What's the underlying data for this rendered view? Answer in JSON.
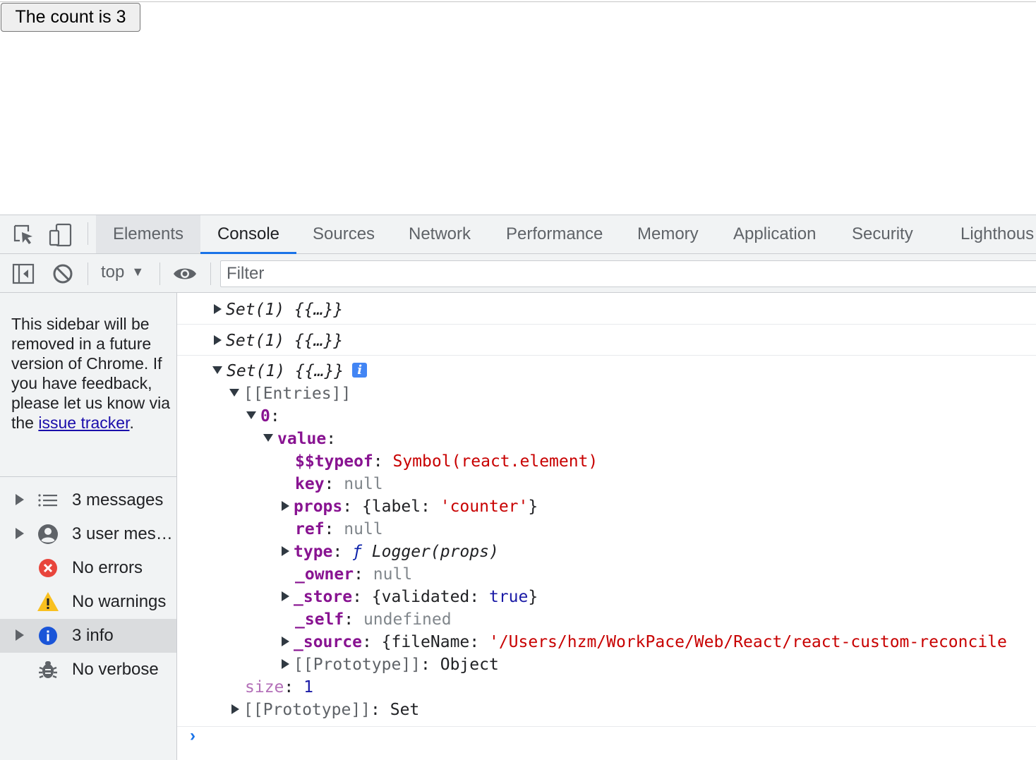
{
  "page": {
    "button_label": "The count is 3"
  },
  "devtools": {
    "tabs": [
      "Elements",
      "Console",
      "Sources",
      "Network",
      "Performance",
      "Memory",
      "Application",
      "Security",
      "Lighthous"
    ],
    "toolbar": {
      "context": "top",
      "filter_placeholder": "Filter"
    },
    "sidebar": {
      "note_text": "This sidebar will be removed in a future version of Chrome. If you have feedback, please let us know via the ",
      "note_link": "issue tracker",
      "note_end": ".",
      "items": [
        {
          "label": "3 messages"
        },
        {
          "label": "3 user mes…"
        },
        {
          "label": "No errors"
        },
        {
          "label": "No warnings"
        },
        {
          "label": "3 info"
        },
        {
          "label": "No verbose"
        }
      ]
    },
    "console": {
      "entry_label": "Set(1) {{…}}",
      "entries_key": "[[Entries]]",
      "index_key": "0",
      "value_key": "value",
      "typeof_key": "$$typeof",
      "typeof_val": "Symbol(react.element)",
      "key_key": "key",
      "null_val": "null",
      "props_key": "props",
      "props_open": "{label: ",
      "props_str": "'counter'",
      "props_close": "}",
      "ref_key": "ref",
      "type_key": "type",
      "type_f": "ƒ",
      "type_val": "Logger(props)",
      "owner_key": "_owner",
      "store_key": "_store",
      "store_open": "{validated: ",
      "store_bool": "true",
      "store_close": "}",
      "self_key": "_self",
      "self_val": "undefined",
      "source_key": "_source",
      "source_open": "{fileName: ",
      "source_str": "'/Users/hzm/WorkPace/Web/React/react-custom-reconcile",
      "proto_key": "[[Prototype]]",
      "proto_obj": "Object",
      "size_key": "size",
      "size_val": "1",
      "proto_set": "Set",
      "prompt": "›"
    }
  },
  "colors": {
    "accent": "#1a73e8",
    "keyword": "#881391",
    "string": "#c80000"
  }
}
